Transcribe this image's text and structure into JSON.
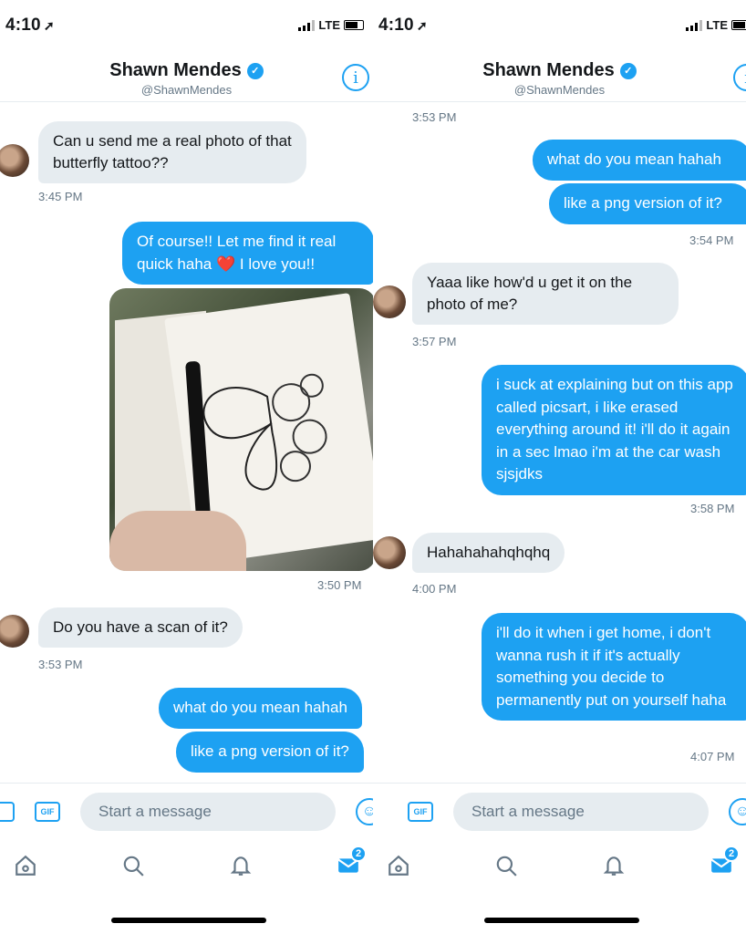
{
  "status": {
    "time": "4:10",
    "network": "LTE"
  },
  "header": {
    "name": "Shawn Mendes",
    "handle": "@ShawnMendes"
  },
  "left": {
    "m1": {
      "text": "Can u send me a real photo of that butterfly tattoo??",
      "time": "3:45 PM"
    },
    "m2": {
      "line1": "Of course!! Let me find it real",
      "line2a": "quick haha",
      "heart": "❤️",
      "line2b": "I love you!!"
    },
    "photo_time": "3:50 PM",
    "m3": {
      "text": "Do you have a scan of it?",
      "time": "3:53 PM"
    },
    "m4": {
      "text": "what do you mean hahah"
    },
    "m5": {
      "text": "like a png version of it?"
    }
  },
  "right": {
    "top_time": "3:53 PM",
    "m1": {
      "text": "what do you mean hahah"
    },
    "m2": {
      "text": "like a png version of it?",
      "time": "3:54 PM"
    },
    "m3": {
      "text": "Yaaa like how'd u get it on the photo of me?",
      "time": "3:57 PM"
    },
    "m4": {
      "text": "i suck at explaining but on this app called picsart, i like erased everything around it! i'll do it again in a sec lmao i'm at the car wash sjsjdks",
      "time": "3:58 PM"
    },
    "m5": {
      "text": "Hahahahahqhqhq",
      "time": "4:00 PM"
    },
    "m6": {
      "text": "i'll do it when i get home, i don't wanna rush it if it's actually something you decide to permanently put on yourself haha",
      "time": "4:07 PM"
    }
  },
  "composer": {
    "placeholder": "Start a message",
    "gif_label": "GIF"
  },
  "tabbar": {
    "messages_badge": "2"
  }
}
